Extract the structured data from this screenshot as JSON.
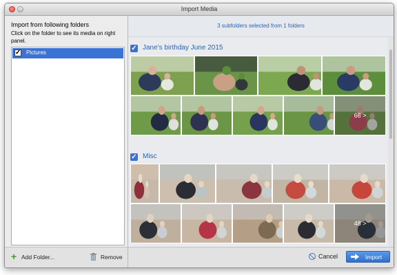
{
  "window": {
    "title": "Import Media"
  },
  "left_panel": {
    "heading": "Import from following folders",
    "subheading": "Click on the folder to see its media on right panel.",
    "folders": [
      {
        "label": "Pictures",
        "checked": true
      }
    ],
    "add_folder_label": "Add Folder...",
    "remove_label": "Remove"
  },
  "right_panel": {
    "selection_text": "3 subfolders selected from 1 folders",
    "groups": [
      {
        "title": "Jane's birthday June 2015",
        "more_count": "66 >",
        "photo_palette": [
          [
            "#7da14f",
            "#f0f0ec",
            "#2d3a5a",
            "#d8b19a"
          ],
          [
            "#6a9448",
            "#2a2d36",
            "#c9a084",
            "#5c8d3e"
          ],
          [
            "#7ca850",
            "#ececec",
            "#2b2b33",
            "#bf9377"
          ],
          [
            "#5d8e3c",
            "#f0f0f0",
            "#293a64",
            "#c99b80"
          ],
          [
            "#6f9b49",
            "#e9e9e9",
            "#222a44",
            "#cfa68b"
          ],
          [
            "#6a9646",
            "#ececec",
            "#2c3250",
            "#c89a7e"
          ],
          [
            "#75a04c",
            "#ececec",
            "#2a3560",
            "#d3a98e"
          ],
          [
            "#699545",
            "#d9dce2",
            "#3a4e7a",
            "#c69a80"
          ],
          [
            "#6f9a48",
            "#f0f0f0",
            "#c2485f",
            "#d4ab91"
          ],
          [
            "#6c9746",
            "#d2d6dd",
            "#2c3c6a",
            "#cb9f82"
          ],
          [
            "#608d3d",
            "#3b3b3b",
            "#e4e4e4",
            "#c59b80"
          ]
        ]
      },
      {
        "title": "Misc",
        "more_count": "48 >",
        "photo_palette": [
          [
            "#c7b9a9",
            "#d3c3ad",
            "#8f2f3a",
            "#e7dbc9"
          ],
          [
            "#cdbfae",
            "#b7c4cc",
            "#2a2d34",
            "#e4d6c2"
          ],
          [
            "#c9bcac",
            "#c4cdd2",
            "#8b3540",
            "#e6d8c6"
          ],
          [
            "#c3b5a3",
            "#d4dde2",
            "#c54a3f",
            "#e9ddcc"
          ],
          [
            "#cab9a6",
            "#cfd7dc",
            "#c8453c",
            "#e7dac8"
          ],
          [
            "#bfb09e",
            "#c9d2d8",
            "#2c2f38",
            "#e0d2bf"
          ],
          [
            "#c6b6a2",
            "#d1d6da",
            "#b53447",
            "#e3d5c1"
          ],
          [
            "#b49e86",
            "#cdd4d8",
            "#7d6a53",
            "#dccab3"
          ],
          [
            "#c8baa8",
            "#d3dbe0",
            "#2b2c33",
            "#e6d9c7"
          ],
          [
            "#c4b7a6",
            "#d0d8dc",
            "#2a3342",
            "#e5d8c6"
          ],
          [
            "#9b8f81",
            "#3a3a3a",
            "#d7d7d7",
            "#cbbba7"
          ]
        ]
      }
    ]
  },
  "footer": {
    "cancel_label": "Cancel",
    "import_label": "Import"
  },
  "colors": {
    "accent": "#3b73d4",
    "link_blue": "#2a63b8",
    "add_green": "#3e9a2d"
  }
}
